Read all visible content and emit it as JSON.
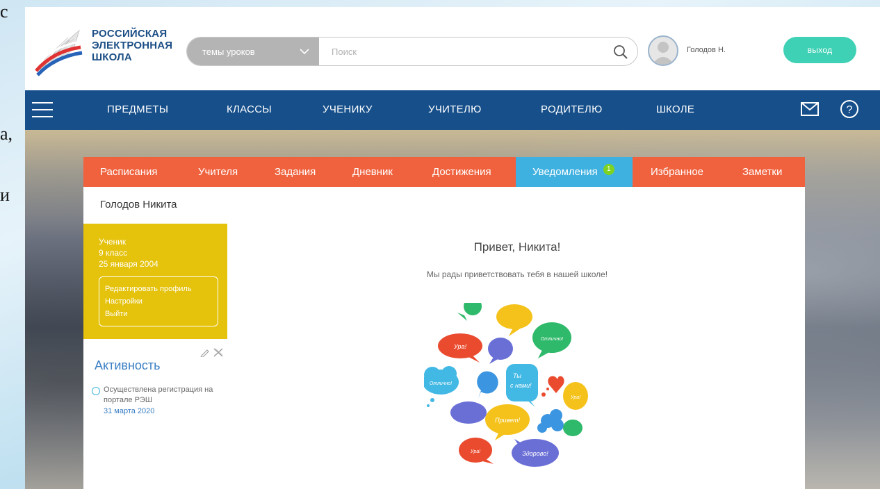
{
  "slide_edge_glyphs": [
    "с",
    "а,",
    "и"
  ],
  "header": {
    "brand_lines": [
      "РОССИЙСКАЯ",
      "ЭЛЕКТРОННАЯ",
      "ШКОЛА"
    ],
    "topic_select_value": "темы уроков",
    "search_placeholder": "Поиск",
    "user_name": "Голодов Н.",
    "logout_label": "выход"
  },
  "nav": {
    "items": [
      "ПРЕДМЕТЫ",
      "КЛАССЫ",
      "УЧЕНИКУ",
      "УЧИТЕЛЮ",
      "РОДИТЕЛЮ",
      "ШКОЛЕ"
    ],
    "icons": [
      "menu-icon",
      "mail-icon",
      "help-icon"
    ]
  },
  "tabs": [
    {
      "label": "Расписания"
    },
    {
      "label": "Учителя"
    },
    {
      "label": "Задания"
    },
    {
      "label": "Дневник"
    },
    {
      "label": "Достижения"
    },
    {
      "label": "Уведомления",
      "badge": "1",
      "active": true
    },
    {
      "label": "Избранное"
    },
    {
      "label": "Заметки"
    }
  ],
  "profile": {
    "full_name": "Голодов Никита",
    "role": "Ученик",
    "grade": "9 класс",
    "birth_date": "25 января 2004",
    "links": [
      "Редактировать профиль",
      "Настройки",
      "Выйти"
    ]
  },
  "activity": {
    "title": "Активность",
    "items": [
      {
        "text": "Осуществлена регистрация на портале РЭШ",
        "date": "31 марта 2020"
      }
    ]
  },
  "welcome": {
    "title": "Привет, Никита!",
    "subtitle": "Мы рады приветствовать тебя в нашей школе!",
    "bubble_words": [
      "Ура!",
      "Отлично!",
      "Отлично!",
      "Ты",
      "с нами!",
      "Ура!",
      "Привет!",
      "Ура!",
      "Здорово!"
    ]
  },
  "colors": {
    "nav_bg": "#164f8a",
    "tabs_bg": "#f0623e",
    "tab_active": "#3fb1e0",
    "profile_bg": "#e5c20c",
    "logout_bg": "#3fd1b5",
    "brand": "#1c4f86"
  }
}
